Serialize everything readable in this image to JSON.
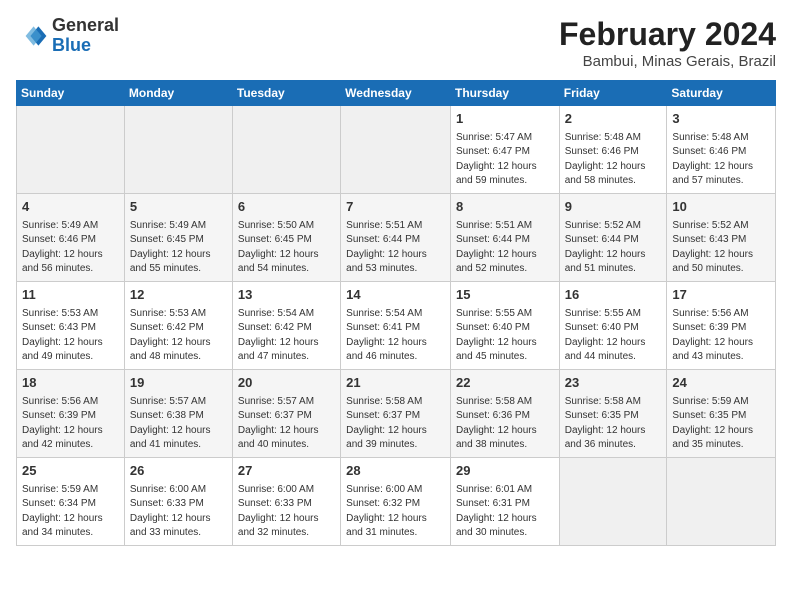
{
  "header": {
    "logo_general": "General",
    "logo_blue": "Blue",
    "month_year": "February 2024",
    "location": "Bambui, Minas Gerais, Brazil"
  },
  "days_of_week": [
    "Sunday",
    "Monday",
    "Tuesday",
    "Wednesday",
    "Thursday",
    "Friday",
    "Saturday"
  ],
  "weeks": [
    [
      {
        "day": "",
        "info": ""
      },
      {
        "day": "",
        "info": ""
      },
      {
        "day": "",
        "info": ""
      },
      {
        "day": "",
        "info": ""
      },
      {
        "day": "1",
        "info": "Sunrise: 5:47 AM\nSunset: 6:47 PM\nDaylight: 12 hours\nand 59 minutes."
      },
      {
        "day": "2",
        "info": "Sunrise: 5:48 AM\nSunset: 6:46 PM\nDaylight: 12 hours\nand 58 minutes."
      },
      {
        "day": "3",
        "info": "Sunrise: 5:48 AM\nSunset: 6:46 PM\nDaylight: 12 hours\nand 57 minutes."
      }
    ],
    [
      {
        "day": "4",
        "info": "Sunrise: 5:49 AM\nSunset: 6:46 PM\nDaylight: 12 hours\nand 56 minutes."
      },
      {
        "day": "5",
        "info": "Sunrise: 5:49 AM\nSunset: 6:45 PM\nDaylight: 12 hours\nand 55 minutes."
      },
      {
        "day": "6",
        "info": "Sunrise: 5:50 AM\nSunset: 6:45 PM\nDaylight: 12 hours\nand 54 minutes."
      },
      {
        "day": "7",
        "info": "Sunrise: 5:51 AM\nSunset: 6:44 PM\nDaylight: 12 hours\nand 53 minutes."
      },
      {
        "day": "8",
        "info": "Sunrise: 5:51 AM\nSunset: 6:44 PM\nDaylight: 12 hours\nand 52 minutes."
      },
      {
        "day": "9",
        "info": "Sunrise: 5:52 AM\nSunset: 6:44 PM\nDaylight: 12 hours\nand 51 minutes."
      },
      {
        "day": "10",
        "info": "Sunrise: 5:52 AM\nSunset: 6:43 PM\nDaylight: 12 hours\nand 50 minutes."
      }
    ],
    [
      {
        "day": "11",
        "info": "Sunrise: 5:53 AM\nSunset: 6:43 PM\nDaylight: 12 hours\nand 49 minutes."
      },
      {
        "day": "12",
        "info": "Sunrise: 5:53 AM\nSunset: 6:42 PM\nDaylight: 12 hours\nand 48 minutes."
      },
      {
        "day": "13",
        "info": "Sunrise: 5:54 AM\nSunset: 6:42 PM\nDaylight: 12 hours\nand 47 minutes."
      },
      {
        "day": "14",
        "info": "Sunrise: 5:54 AM\nSunset: 6:41 PM\nDaylight: 12 hours\nand 46 minutes."
      },
      {
        "day": "15",
        "info": "Sunrise: 5:55 AM\nSunset: 6:40 PM\nDaylight: 12 hours\nand 45 minutes."
      },
      {
        "day": "16",
        "info": "Sunrise: 5:55 AM\nSunset: 6:40 PM\nDaylight: 12 hours\nand 44 minutes."
      },
      {
        "day": "17",
        "info": "Sunrise: 5:56 AM\nSunset: 6:39 PM\nDaylight: 12 hours\nand 43 minutes."
      }
    ],
    [
      {
        "day": "18",
        "info": "Sunrise: 5:56 AM\nSunset: 6:39 PM\nDaylight: 12 hours\nand 42 minutes."
      },
      {
        "day": "19",
        "info": "Sunrise: 5:57 AM\nSunset: 6:38 PM\nDaylight: 12 hours\nand 41 minutes."
      },
      {
        "day": "20",
        "info": "Sunrise: 5:57 AM\nSunset: 6:37 PM\nDaylight: 12 hours\nand 40 minutes."
      },
      {
        "day": "21",
        "info": "Sunrise: 5:58 AM\nSunset: 6:37 PM\nDaylight: 12 hours\nand 39 minutes."
      },
      {
        "day": "22",
        "info": "Sunrise: 5:58 AM\nSunset: 6:36 PM\nDaylight: 12 hours\nand 38 minutes."
      },
      {
        "day": "23",
        "info": "Sunrise: 5:58 AM\nSunset: 6:35 PM\nDaylight: 12 hours\nand 36 minutes."
      },
      {
        "day": "24",
        "info": "Sunrise: 5:59 AM\nSunset: 6:35 PM\nDaylight: 12 hours\nand 35 minutes."
      }
    ],
    [
      {
        "day": "25",
        "info": "Sunrise: 5:59 AM\nSunset: 6:34 PM\nDaylight: 12 hours\nand 34 minutes."
      },
      {
        "day": "26",
        "info": "Sunrise: 6:00 AM\nSunset: 6:33 PM\nDaylight: 12 hours\nand 33 minutes."
      },
      {
        "day": "27",
        "info": "Sunrise: 6:00 AM\nSunset: 6:33 PM\nDaylight: 12 hours\nand 32 minutes."
      },
      {
        "day": "28",
        "info": "Sunrise: 6:00 AM\nSunset: 6:32 PM\nDaylight: 12 hours\nand 31 minutes."
      },
      {
        "day": "29",
        "info": "Sunrise: 6:01 AM\nSunset: 6:31 PM\nDaylight: 12 hours\nand 30 minutes."
      },
      {
        "day": "",
        "info": ""
      },
      {
        "day": "",
        "info": ""
      }
    ]
  ]
}
